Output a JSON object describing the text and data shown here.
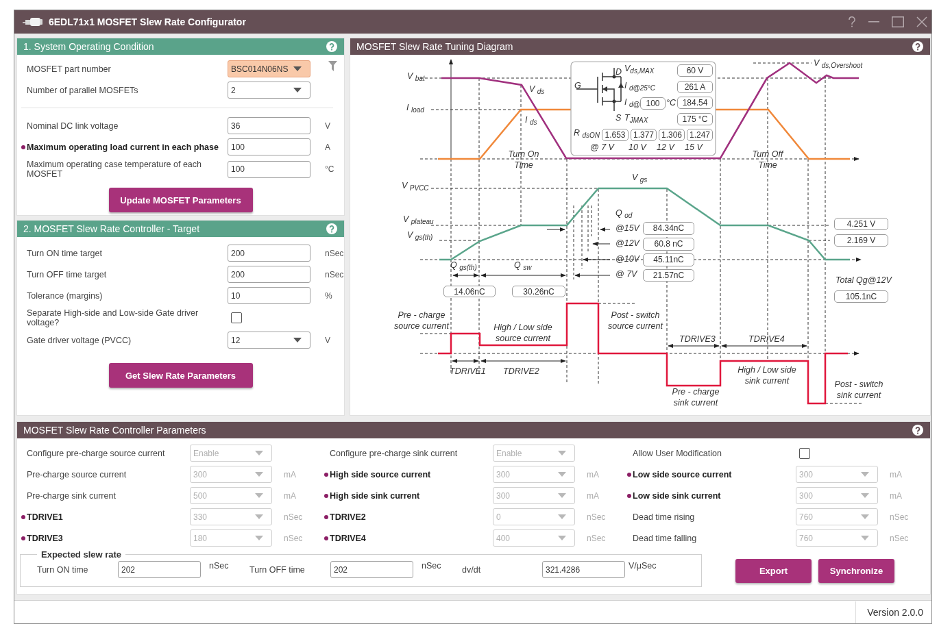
{
  "window": {
    "title": "6EDL71x1 MOSFET Slew Rate Configurator"
  },
  "system_panel": {
    "title": "1. System Operating Condition",
    "groups": [
      [
        {
          "label": "MOSFET part number",
          "kind": "dropdown",
          "value": "BSC014N06NS",
          "highlighted": true,
          "filter": true,
          "marked": false
        },
        {
          "label": "Number of parallel MOSFETs",
          "kind": "dropdown",
          "value": "2",
          "highlighted": false,
          "filter": false,
          "marked": false
        }
      ],
      [
        {
          "label": "Nominal DC link voltage",
          "kind": "input",
          "value": "36",
          "unit": "V",
          "marked": false
        },
        {
          "label": "Maximum operating load current in each phase",
          "kind": "input",
          "value": "100",
          "unit": "A",
          "marked": true
        },
        {
          "label": "Maximum operating case temperature of each MOSFET",
          "kind": "input",
          "value": "100",
          "unit": "°C",
          "marked": false
        }
      ]
    ],
    "button": "Update MOSFET Parameters"
  },
  "target_panel": {
    "title": "2. MOSFET Slew Rate Controller - Target",
    "fields": [
      {
        "label": "Turn ON time target",
        "kind": "input",
        "value": "200",
        "unit": "nSec",
        "marked": false
      },
      {
        "label": "Turn OFF time target",
        "kind": "input",
        "value": "200",
        "unit": "nSec",
        "marked": false
      },
      {
        "label": "Tolerance (margins)",
        "kind": "input",
        "value": "10",
        "unit": "%",
        "marked": false
      },
      {
        "label": "Separate High-side and Low-side Gate driver voltage?",
        "kind": "checkbox",
        "checked": false,
        "marked": false
      },
      {
        "label": "Gate driver voltage (PVCC)",
        "kind": "dropdown",
        "value": "12",
        "unit": "V",
        "marked": false
      }
    ],
    "button": "Get Slew Rate Parameters"
  },
  "diagram": {
    "title": "MOSFET Slew Rate Tuning Diagram",
    "mosfet": {
      "labels": [
        "D",
        "V$_{ds,MAX}$",
        "G",
        "I $_{d@25°C}$",
        "I $_{d@}$",
        "°C",
        "S",
        "T$_{JMAX}$",
        "R $_{dsON}$",
        "@ 7 V",
        "10 V",
        "12 V",
        "15 V"
      ],
      "values": [
        "60 V",
        "261 A",
        "100",
        "184.54",
        "175 °C",
        "1.653",
        "1.377",
        "1.306",
        "1.247"
      ]
    },
    "labels": [
      "V $_{bat}$",
      "V $_{ds,Overshoot}$",
      "V $_{ds}$",
      "I $_{load}$",
      "I $_{ds}$",
      "Turn On Time",
      "Turn Off Time",
      "V $_{PVCC}$",
      "V $_{gs}$",
      "Q $_{od}$",
      "V $_{plateau}$",
      "@15V",
      "V $_{gs(th)}$",
      "@12V",
      "@10V",
      "Q $_{gs(th)}$",
      "Q $_{sw}$",
      "@ 7V",
      "Total Qg@12V",
      "Pre - charge source current",
      "Post - switch source current",
      "High / Low side source current",
      "TDRIVE3",
      "TDRIVE4",
      "TDRIVE1",
      "TDRIVE2",
      "High / Low side sink current",
      "Pre - charge sink current",
      "Post - switch sink current"
    ],
    "values": [
      "4.251 V",
      "84.34nC",
      "2.169 V",
      "60.8 nC",
      "45.11nC",
      "21.57nC",
      "14.06nC",
      "30.26nC",
      "105.1nC"
    ]
  },
  "parameters_panel": {
    "title": "MOSFET Slew Rate Controller Parameters",
    "rows": [
      [
        {
          "label": "Configure pre-charge source current",
          "kind": "dropdown",
          "value": "Enable",
          "disabled": true,
          "marked": false
        },
        {
          "label": "Configure pre-charge sink current",
          "kind": "dropdown",
          "value": "Enable",
          "disabled": true,
          "marked": false
        },
        {
          "label": "Allow User Modification",
          "kind": "checkbox",
          "checked": false,
          "marked": false
        }
      ],
      [
        {
          "label": "Pre-charge source current",
          "kind": "dropdown",
          "value": "300",
          "unit": "mA",
          "disabled": true,
          "marked": false
        },
        {
          "label": "High side source current",
          "kind": "dropdown",
          "value": "300",
          "unit": "mA",
          "disabled": true,
          "marked": true
        },
        {
          "label": "Low side source current",
          "kind": "dropdown",
          "value": "300",
          "unit": "mA",
          "disabled": true,
          "marked": true
        }
      ],
      [
        {
          "label": "Pre-charge sink current",
          "kind": "dropdown",
          "value": "500",
          "unit": "mA",
          "disabled": true,
          "marked": false
        },
        {
          "label": "High side sink current",
          "kind": "dropdown",
          "value": "300",
          "unit": "mA",
          "disabled": true,
          "marked": true
        },
        {
          "label": "Low side sink current",
          "kind": "dropdown",
          "value": "300",
          "unit": "mA",
          "disabled": true,
          "marked": true
        }
      ],
      [
        {
          "label": "TDRIVE1",
          "kind": "dropdown",
          "value": "330",
          "unit": "nSec",
          "disabled": true,
          "marked": true
        },
        {
          "label": "TDRIVE2",
          "kind": "dropdown",
          "value": "0",
          "unit": "nSec",
          "disabled": true,
          "marked": true
        },
        {
          "label": "Dead time rising",
          "kind": "dropdown",
          "value": "760",
          "unit": "nSec",
          "disabled": true,
          "marked": false
        }
      ],
      [
        {
          "label": "TDRIVE3",
          "kind": "dropdown",
          "value": "180",
          "unit": "nSec",
          "disabled": true,
          "marked": true
        },
        {
          "label": "TDRIVE4",
          "kind": "dropdown",
          "value": "400",
          "unit": "nSec",
          "disabled": true,
          "marked": true
        },
        {
          "label": "Dead time falling",
          "kind": "dropdown",
          "value": "760",
          "unit": "nSec",
          "disabled": true,
          "marked": false
        }
      ]
    ],
    "expected": {
      "legend": "Expected slew rate",
      "items": [
        {
          "label": "Turn ON time",
          "value": "202",
          "unit": "nSec"
        },
        {
          "label": "Turn OFF time",
          "value": "202",
          "unit": "nSec"
        },
        {
          "label": "dv/dt",
          "value": "321.4286",
          "unit": "V/μSec"
        }
      ]
    },
    "buttons": [
      "Export",
      "Synchronize"
    ]
  },
  "status_bar": {
    "version": "Version 2.0.0"
  }
}
